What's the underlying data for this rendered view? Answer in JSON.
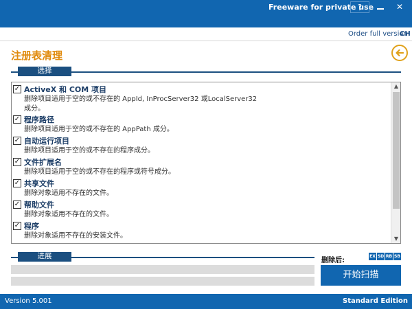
{
  "titlebar": {
    "text": "Freeware for private use",
    "help": "?",
    "close": "✕"
  },
  "menu": {
    "order_link": "Order full version",
    "lang": "CH"
  },
  "page": {
    "heading": "注册表清理"
  },
  "select_section": {
    "label": "选择"
  },
  "items": [
    {
      "name": "ActiveX 和 COM 项目",
      "desc": "删除项目适用于空的或不存在的 AppId, InProcServer32 或LocalServer32 成分。",
      "checked": true
    },
    {
      "name": "程序路径",
      "desc": "删除项目适用于空的或不存在的 AppPath 成分。",
      "checked": true
    },
    {
      "name": "自动运行项目",
      "desc": "删除项目适用于空的或不存在的程序成分。",
      "checked": true
    },
    {
      "name": "文件扩展名",
      "desc": "删除项目适用于空的或不存在的程序或符号成分。",
      "checked": true
    },
    {
      "name": "共享文件",
      "desc": "删除对象适用不存在的文件。",
      "checked": true
    },
    {
      "name": "帮助文件",
      "desc": "删除对象适用不存在的文件。",
      "checked": true
    },
    {
      "name": "程序",
      "desc": "删除对象适用不存在的安装文件。",
      "checked": true
    }
  ],
  "progress_section": {
    "label": "进展"
  },
  "progress": {
    "bar1": 0,
    "bar2": 0
  },
  "after": {
    "label": "删除后:",
    "badges": [
      "EX",
      "SD",
      "RB",
      "SB"
    ]
  },
  "start_button": {
    "label": "开始扫描"
  },
  "status": {
    "version": "Version 5.001",
    "edition": "Standard Edition"
  },
  "colors": {
    "primary": "#1166b0",
    "accent": "#e08a0c",
    "section": "#1b4f80"
  }
}
